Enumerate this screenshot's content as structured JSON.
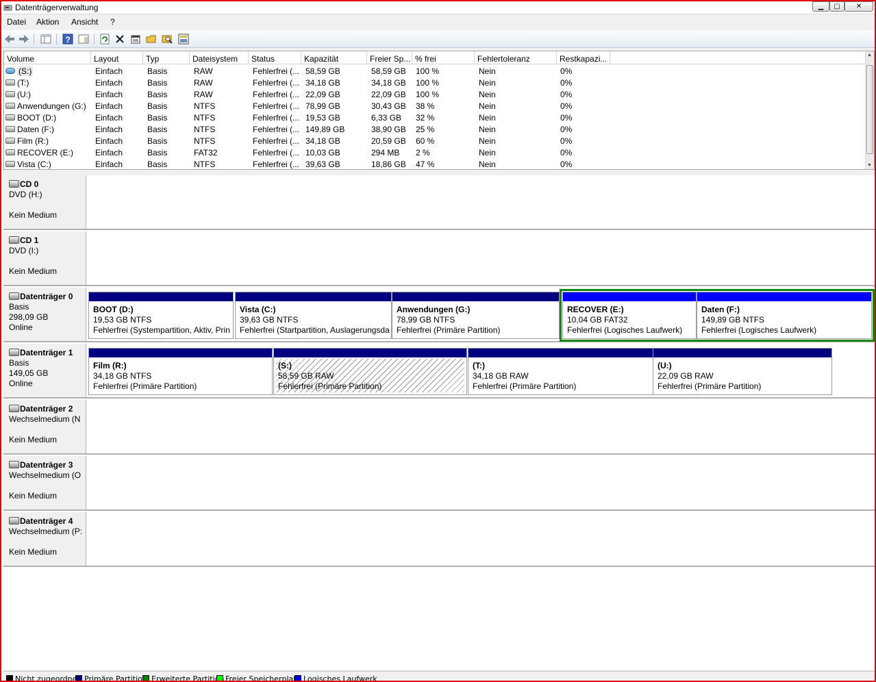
{
  "window": {
    "title": "Datenträgerverwaltung",
    "minimize": "▁",
    "maximize": "▢",
    "close": "✕"
  },
  "menu": [
    "Datei",
    "Aktion",
    "Ansicht",
    "?"
  ],
  "toolbar": {
    "buttons": [
      "back-icon",
      "forward-icon",
      "console-tree-icon",
      "help-icon",
      "action-pane-icon",
      "refresh-icon",
      "delete-icon",
      "properties-icon",
      "open-icon",
      "explore-icon",
      "settings-icon"
    ]
  },
  "volumes": {
    "columns": [
      "Volume",
      "Layout",
      "Typ",
      "Dateisystem",
      "Status",
      "Kapazität",
      "Freier Sp...",
      "% frei",
      "Fehlertoleranz",
      "Restkapazi..."
    ],
    "rows": [
      {
        "icon": "blue",
        "name": "(S:)",
        "layout": "Einfach",
        "typ": "Basis",
        "fs": "RAW",
        "status": "Fehlerfrei (...",
        "cap": "58,59 GB",
        "free": "58,59 GB",
        "pct": "100 %",
        "ft": "Nein",
        "rest": "0%"
      },
      {
        "icon": "grey",
        "name": "(T:)",
        "layout": "Einfach",
        "typ": "Basis",
        "fs": "RAW",
        "status": "Fehlerfrei (...",
        "cap": "34,18 GB",
        "free": "34,18 GB",
        "pct": "100 %",
        "ft": "Nein",
        "rest": "0%"
      },
      {
        "icon": "grey",
        "name": "(U:)",
        "layout": "Einfach",
        "typ": "Basis",
        "fs": "RAW",
        "status": "Fehlerfrei (...",
        "cap": "22,09 GB",
        "free": "22,09 GB",
        "pct": "100 %",
        "ft": "Nein",
        "rest": "0%"
      },
      {
        "icon": "grey",
        "name": "Anwendungen (G:)",
        "layout": "Einfach",
        "typ": "Basis",
        "fs": "NTFS",
        "status": "Fehlerfrei (...",
        "cap": "78,99 GB",
        "free": "30,43 GB",
        "pct": "38 %",
        "ft": "Nein",
        "rest": "0%"
      },
      {
        "icon": "grey",
        "name": "BOOT (D:)",
        "layout": "Einfach",
        "typ": "Basis",
        "fs": "NTFS",
        "status": "Fehlerfrei (...",
        "cap": "19,53 GB",
        "free": "6,33 GB",
        "pct": "32 %",
        "ft": "Nein",
        "rest": "0%"
      },
      {
        "icon": "grey",
        "name": "Daten (F:)",
        "layout": "Einfach",
        "typ": "Basis",
        "fs": "NTFS",
        "status": "Fehlerfrei (...",
        "cap": "149,89 GB",
        "free": "38,90 GB",
        "pct": "25 %",
        "ft": "Nein",
        "rest": "0%"
      },
      {
        "icon": "grey",
        "name": "Film (R:)",
        "layout": "Einfach",
        "typ": "Basis",
        "fs": "NTFS",
        "status": "Fehlerfrei (...",
        "cap": "34,18 GB",
        "free": "20,59 GB",
        "pct": "60 %",
        "ft": "Nein",
        "rest": "0%"
      },
      {
        "icon": "grey",
        "name": "RECOVER (E:)",
        "layout": "Einfach",
        "typ": "Basis",
        "fs": "FAT32",
        "status": "Fehlerfrei (...",
        "cap": "10,03 GB",
        "free": "294 MB",
        "pct": "2 %",
        "ft": "Nein",
        "rest": "0%"
      },
      {
        "icon": "grey",
        "name": "Vista (C:)",
        "layout": "Einfach",
        "typ": "Basis",
        "fs": "NTFS",
        "status": "Fehlerfrei (...",
        "cap": "39,63 GB",
        "free": "18,86 GB",
        "pct": "47 %",
        "ft": "Nein",
        "rest": "0%"
      }
    ]
  },
  "disks": [
    {
      "title": "CD 0",
      "lines": [
        "DVD (H:)",
        "",
        "Kein Medium"
      ],
      "partitions": []
    },
    {
      "title": "CD 1",
      "lines": [
        "DVD (I:)",
        "",
        "Kein Medium"
      ],
      "partitions": []
    },
    {
      "title": "Datenträger 0",
      "lines": [
        "Basis",
        "298,09 GB",
        "Online"
      ],
      "partitions": [
        {
          "name": "BOOT  (D:)",
          "size": "19,53 GB NTFS",
          "status": "Fehlerfrei (Systempartition, Aktiv, Prin",
          "kind": "primary"
        },
        {
          "name": "Vista  (C:)",
          "size": "39,63 GB NTFS",
          "status": "Fehlerfrei (Startpartition, Auslagerungsda",
          "kind": "primary"
        },
        {
          "name": "Anwendungen  (G:)",
          "size": "78,99 GB NTFS",
          "status": "Fehlerfrei (Primäre Partition)",
          "kind": "primary"
        },
        {
          "name": "RECOVER  (E:)",
          "size": "10,04 GB FAT32",
          "status": "Fehlerfrei (Logisches Laufwerk)",
          "kind": "logical"
        },
        {
          "name": "Daten  (F:)",
          "size": "149,89 GB NTFS",
          "status": "Fehlerfrei (Logisches Laufwerk)",
          "kind": "logical"
        }
      ]
    },
    {
      "title": "Datenträger 1",
      "lines": [
        "Basis",
        "149,05 GB",
        "Online"
      ],
      "partitions": [
        {
          "name": "Film  (R:)",
          "size": "34,18 GB NTFS",
          "status": "Fehlerfrei (Primäre Partition)",
          "kind": "primary"
        },
        {
          "name": "(S:)",
          "size": "58,59 GB RAW",
          "status": "Fehlerfrei (Primäre Partition)",
          "kind": "primary",
          "selected": true
        },
        {
          "name": "(T:)",
          "size": "34,18 GB RAW",
          "status": "Fehlerfrei (Primäre Partition)",
          "kind": "primary"
        },
        {
          "name": "(U:)",
          "size": "22,09 GB RAW",
          "status": "Fehlerfrei (Primäre Partition)",
          "kind": "primary"
        }
      ]
    },
    {
      "title": "Datenträger 2",
      "lines": [
        "Wechselmedium (N",
        "",
        "Kein Medium"
      ],
      "partitions": []
    },
    {
      "title": "Datenträger 3",
      "lines": [
        "Wechselmedium (O",
        "",
        "Kein Medium"
      ],
      "partitions": []
    },
    {
      "title": "Datenträger 4",
      "lines": [
        "Wechselmedium (P:",
        "",
        "Kein Medium"
      ],
      "partitions": []
    }
  ],
  "legend": [
    {
      "label": "Nicht zugeordnet",
      "color": "#000000"
    },
    {
      "label": "Primäre Partition",
      "color": "#000080"
    },
    {
      "label": "Erweiterte Partition",
      "color": "#008000"
    },
    {
      "label": "Freier Speicherplatz",
      "color": "#00ff00"
    },
    {
      "label": "Logisches Laufwerk",
      "color": "#0000ff"
    }
  ],
  "colors": {
    "primary": "#000080",
    "logical": "#0000ff",
    "extended": "#148a14",
    "accent_border": "#e00000"
  }
}
